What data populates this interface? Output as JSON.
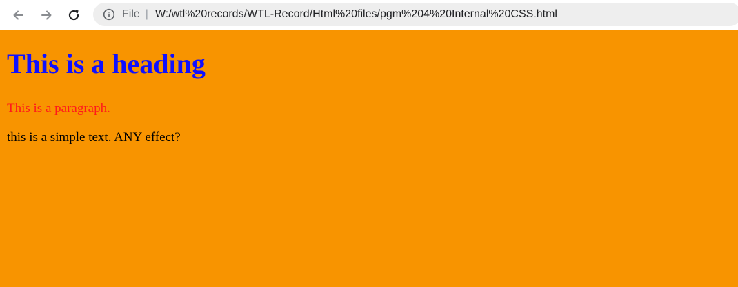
{
  "browser": {
    "back_icon": "arrow-left-icon",
    "forward_icon": "arrow-right-icon",
    "reload_icon": "reload-icon",
    "info_icon": "info-circle-icon",
    "file_label": "File",
    "separator": "|",
    "url": "W:/wtl%20records/WTL-Record/Html%20files/pgm%204%20Internal%20CSS.html"
  },
  "page": {
    "background_color": "#f89400",
    "heading": "This is a heading",
    "heading_color": "#1010ff",
    "paragraph": "This is a paragraph.",
    "paragraph_color": "#ff1a1a",
    "simple_text": "this is a simple text. ANY effect?"
  }
}
